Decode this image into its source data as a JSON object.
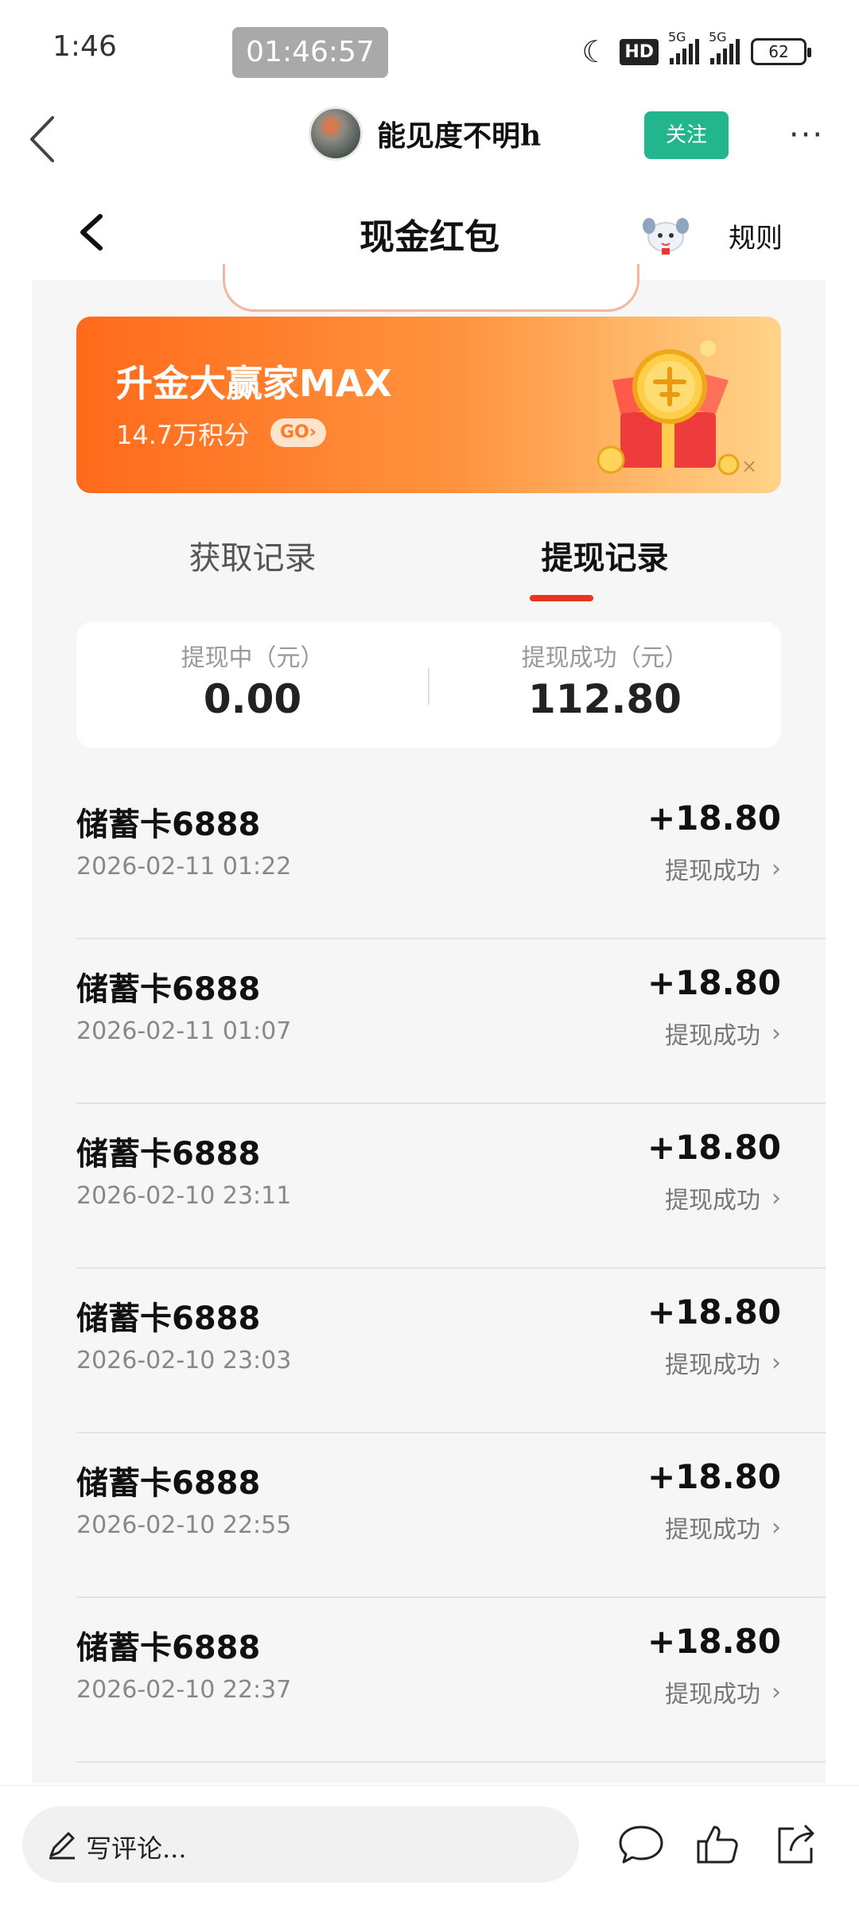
{
  "status_bar": {
    "time": "1:46",
    "recording": "01:46:57",
    "hd": "HD",
    "network_1": "5G",
    "network_2": "5G",
    "battery": "62",
    "icons": [
      "moon-icon",
      "hd-icon",
      "signal-icon",
      "signal-icon",
      "battery-icon"
    ]
  },
  "app_header": {
    "author": "能见度不明h",
    "follow_label": "关注",
    "more_label": "···"
  },
  "page": {
    "title": "现金红包",
    "rules": "规则"
  },
  "promo": {
    "title": "升金大赢家MAX",
    "subtitle": "14.7万积分",
    "go": "GO›",
    "close": "×"
  },
  "tabs": [
    {
      "label": "获取记录",
      "active": false
    },
    {
      "label": "提现记录",
      "active": true
    }
  ],
  "summary": {
    "pending_label": "提现中（元）",
    "pending_value": "0.00",
    "success_label": "提现成功（元）",
    "success_value": "112.80"
  },
  "records": [
    {
      "title": "储蓄卡6888",
      "time": "2026-02-11 01:22",
      "amount": "+18.80",
      "status": "提现成功"
    },
    {
      "title": "储蓄卡6888",
      "time": "2026-02-11 01:07",
      "amount": "+18.80",
      "status": "提现成功"
    },
    {
      "title": "储蓄卡6888",
      "time": "2026-02-10 23:11",
      "amount": "+18.80",
      "status": "提现成功"
    },
    {
      "title": "储蓄卡6888",
      "time": "2026-02-10 23:03",
      "amount": "+18.80",
      "status": "提现成功"
    },
    {
      "title": "储蓄卡6888",
      "time": "2026-02-10 22:55",
      "amount": "+18.80",
      "status": "提现成功"
    },
    {
      "title": "储蓄卡6888",
      "time": "2026-02-10 22:37",
      "amount": "+18.80",
      "status": "提现成功"
    }
  ],
  "bottom_bar": {
    "comment_placeholder": "写评论...",
    "icons": [
      "comment-icon",
      "like-icon",
      "share-icon"
    ]
  },
  "colors": {
    "follow_green": "#23b58c",
    "tab_indicator": "#e8341f",
    "banner_start": "#ff6a1a",
    "banner_end": "#ffd48a"
  }
}
